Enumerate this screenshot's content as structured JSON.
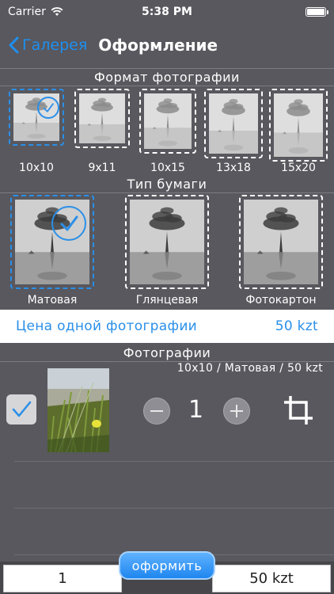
{
  "status_bar": {
    "carrier": "Carrier",
    "time": "5:38 PM"
  },
  "nav": {
    "back_label": "Галерея",
    "title": "Оформление"
  },
  "format_section": {
    "title": "Формат фотографии",
    "options": [
      {
        "label": "10x10",
        "selected": true
      },
      {
        "label": "9x11",
        "selected": false
      },
      {
        "label": "10x15",
        "selected": false
      },
      {
        "label": "13x18",
        "selected": false
      },
      {
        "label": "15x20",
        "selected": false
      }
    ]
  },
  "paper_section": {
    "title": "Тип бумаги",
    "options": [
      {
        "label": "Матовая",
        "selected": true
      },
      {
        "label": "Глянцевая",
        "selected": false
      },
      {
        "label": "Фотокартон",
        "selected": false
      }
    ]
  },
  "price": {
    "label": "Цена одной фотографии",
    "value": "50 kzt"
  },
  "photos_section": {
    "title": "Фотографии",
    "items": [
      {
        "description": "10x10 / Матовая / 50 kzt",
        "quantity": "1",
        "checked": true
      }
    ]
  },
  "bottom": {
    "count": "1",
    "order_label": "оформить",
    "total": "50 kzt"
  },
  "colors": {
    "accent": "#2a8fe8",
    "background": "#58585e"
  }
}
